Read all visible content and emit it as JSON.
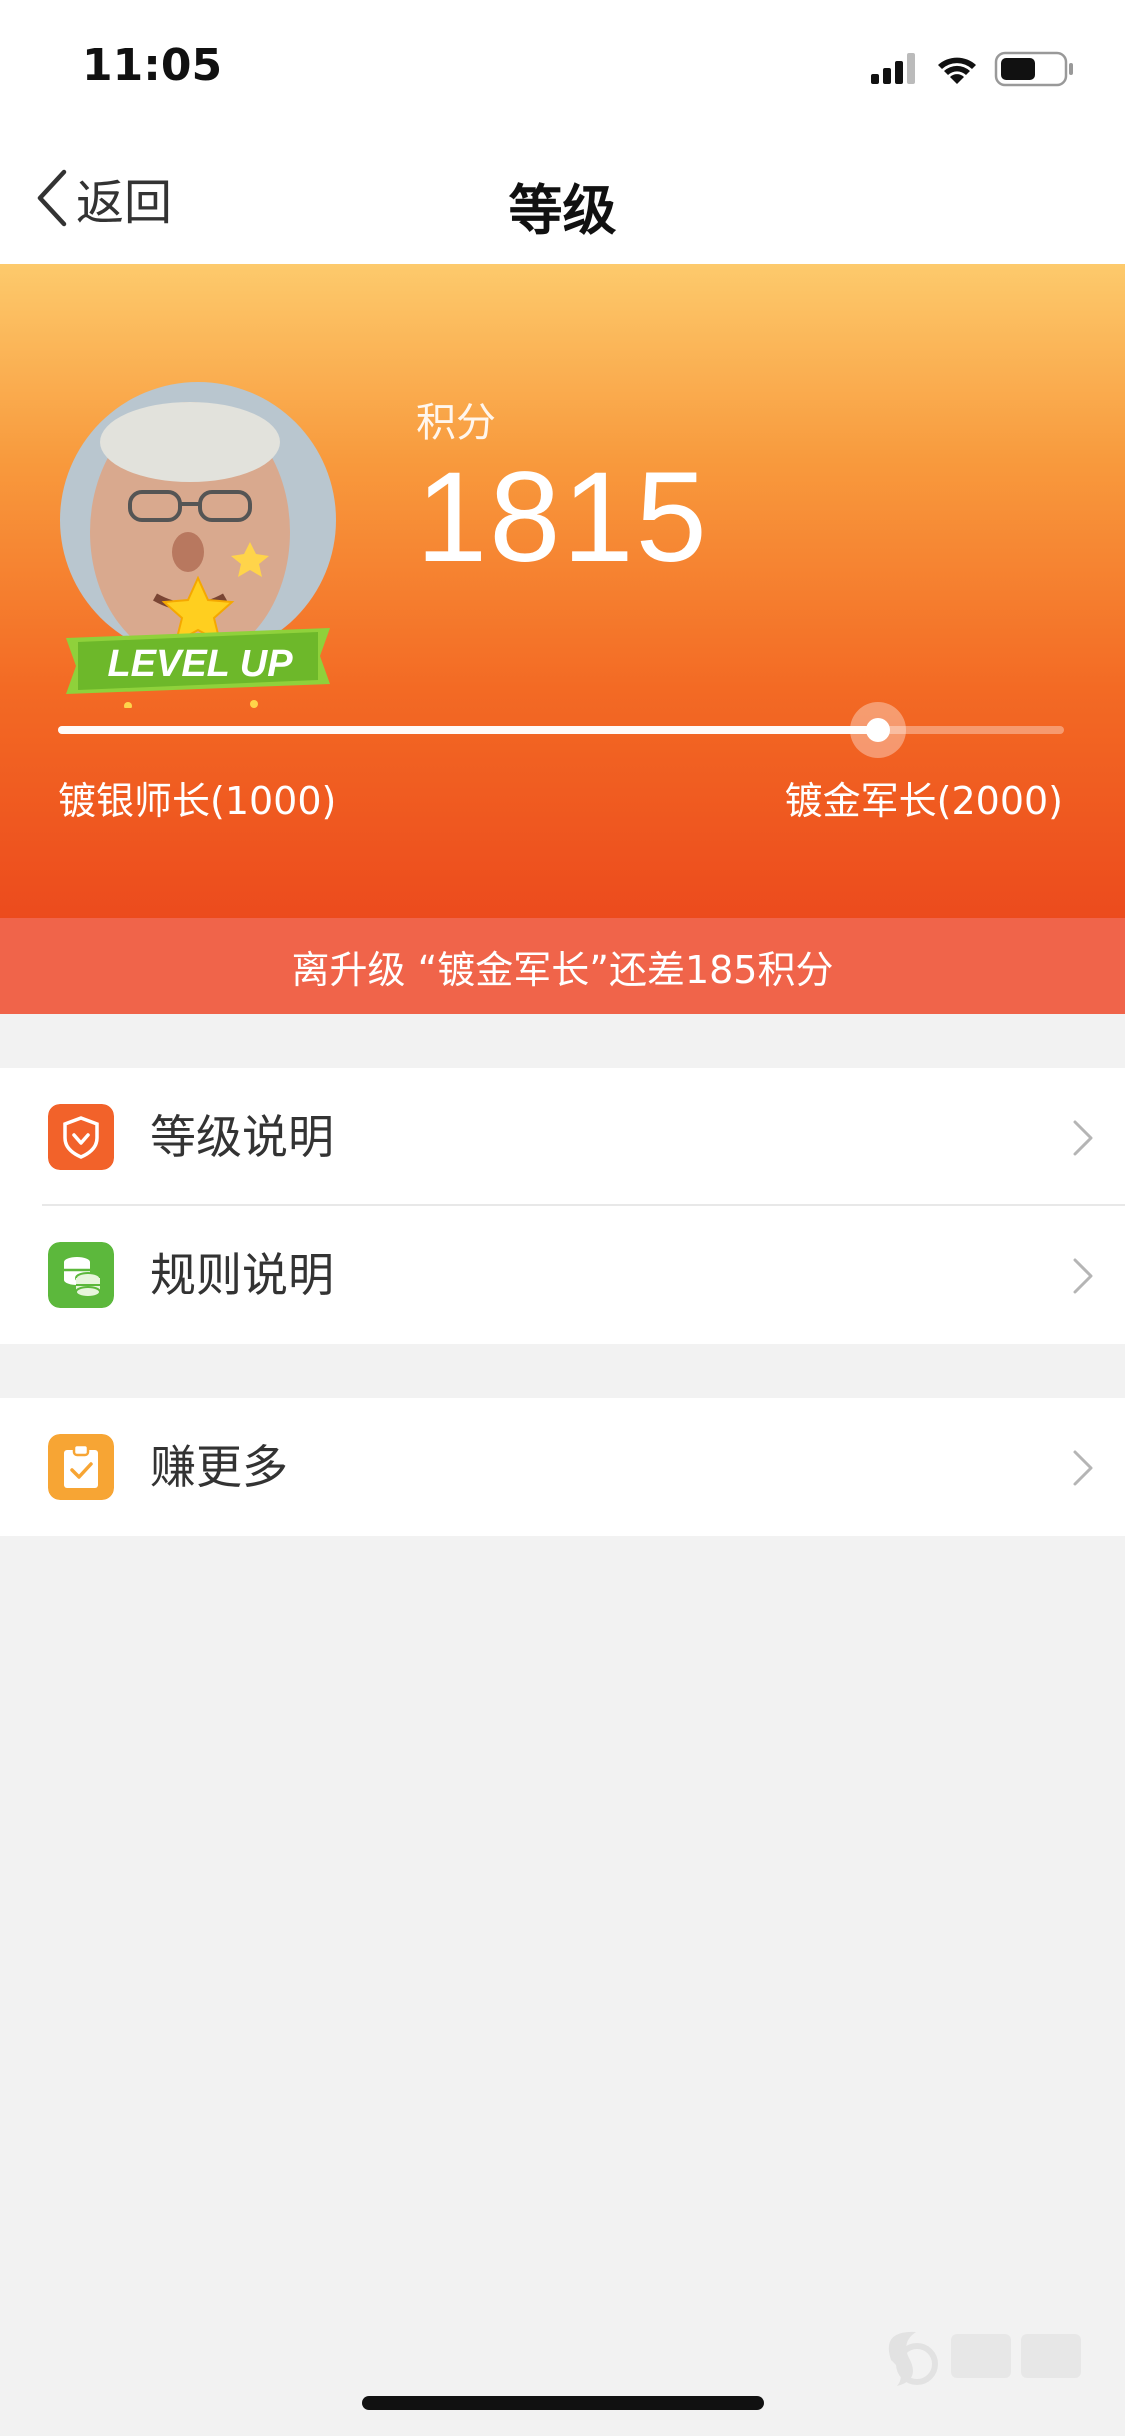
{
  "status_bar": {
    "time": "11:05"
  },
  "nav": {
    "back_label": "返回",
    "title": "等级"
  },
  "hero": {
    "avatar_badge_text": "LEVEL UP",
    "score_label": "积分",
    "score_value": "1815",
    "progress": {
      "current": 1815,
      "min": 1000,
      "max": 2000
    },
    "level_current": "镀银师长(1000)",
    "level_next": "镀金军长(2000)"
  },
  "banner": {
    "text": "离升级 “镀金军长”还差185积分"
  },
  "menu": {
    "items": [
      {
        "label": "等级说明",
        "icon": "shield-icon",
        "color": "#f2622a"
      },
      {
        "label": "规则说明",
        "icon": "coins-icon",
        "color": "#5cb83c"
      }
    ],
    "earn": {
      "label": "赚更多",
      "icon": "clipboard-check-icon",
      "color": "#f7a534"
    }
  },
  "colors": {
    "gradient_top": "#fdca6c",
    "gradient_bottom": "#ec4b1d",
    "banner": "#f0644a",
    "background": "#f2f2f2"
  }
}
